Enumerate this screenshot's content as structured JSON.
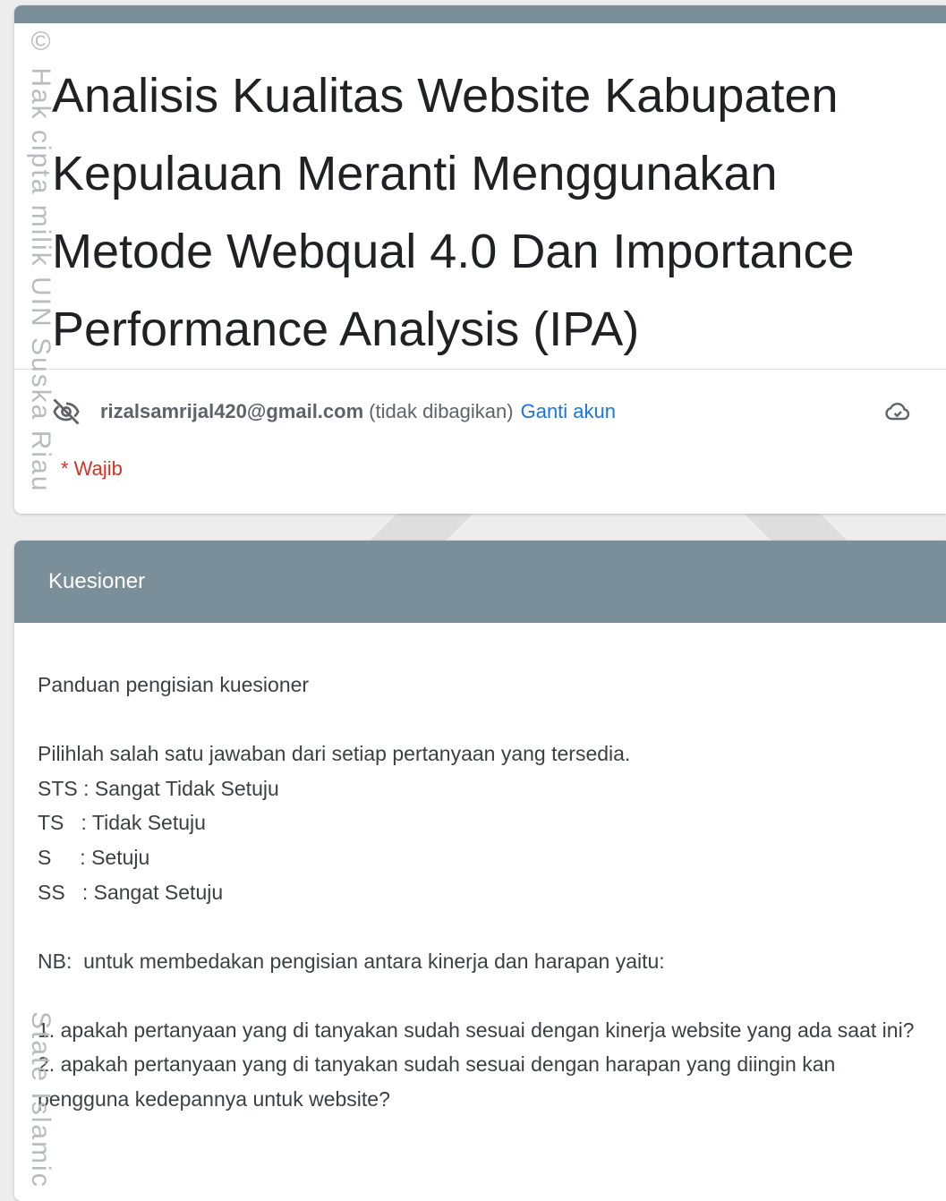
{
  "watermark": {
    "top_text": "© Hak cipta milik UIN Suska Riau",
    "bottom_text": "State Islamic"
  },
  "form": {
    "title": "Analisis Kualitas Website Kabupaten Kepulauan Meranti Menggunakan Metode Webqual 4.0 Dan Importance Performance Analysis (IPA)",
    "account_email": "rizalsamrijal420@gmail.com",
    "not_shared_text": "(tidak dibagikan)",
    "switch_account_label": "Ganti akun",
    "required_note": "* Wajib",
    "icons": {
      "privacy": "eye-off-icon",
      "save_status": "cloud-saved-icon"
    }
  },
  "section": {
    "header": "Kuesioner",
    "guide_title": "Panduan pengisian kuesioner",
    "instruction": "Pilihlah salah satu jawaban dari setiap pertanyaan yang tersedia.",
    "scale": [
      "STS : Sangat Tidak Setuju",
      "TS   : Tidak Setuju",
      "S     : Setuju",
      "SS   : Sangat Setuju"
    ],
    "note": "NB:  untuk membedakan pengisian antara kinerja dan harapan yaitu:",
    "items": [
      "1. apakah pertanyaan yang di tanyakan sudah sesuai dengan kinerja website yang ada saat ini?",
      "2. apakah pertanyaan yang di tanyakan sudah sesuai dengan harapan yang diingin kan pengguna kedepannya untuk website?"
    ]
  },
  "colors": {
    "header_stripe": "#7a8f99",
    "link": "#1a73e8",
    "required": "#d93025"
  }
}
